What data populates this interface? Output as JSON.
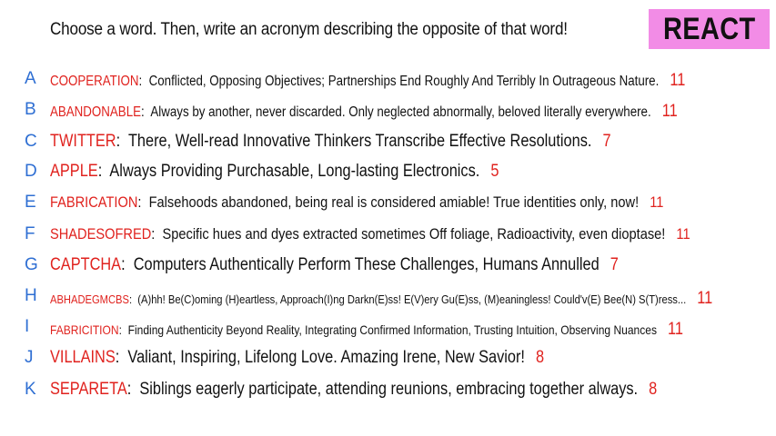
{
  "prompt": "Choose a word. Then, write an acronym describing the opposite of that word!",
  "badge": "REACT",
  "entries": [
    {
      "letter": "A",
      "word": "COOPERATION",
      "acronym": "Conflicted, Opposing Objectives; Partnerships End Roughly And Terribly In Outrageous Nature.",
      "count": "11"
    },
    {
      "letter": "B",
      "word": "ABANDONABLE",
      "acronym": "Always by another, never discarded. Only neglected abnormally, beloved literally everywhere.",
      "count": "11"
    },
    {
      "letter": "C",
      "word": "TWITTER",
      "acronym": "There, Well-read Innovative Thinkers Transcribe Effective Resolutions.",
      "count": "7"
    },
    {
      "letter": "D",
      "word": "APPLE",
      "acronym": "Always Providing Purchasable, Long-lasting Electronics.",
      "count": "5"
    },
    {
      "letter": "E",
      "word": "FABRICATION",
      "acronym": "Falsehoods abandoned, being real is considered amiable! True identities only, now!",
      "count": "11"
    },
    {
      "letter": "F",
      "word": "SHADESOFRED",
      "acronym": "Specific hues and dyes extracted sometimes Off foliage, Radioactivity, even dioptase!",
      "count": "11"
    },
    {
      "letter": "G",
      "word": "CAPTCHA",
      "acronym": "Computers Authentically Perform These Challenges, Humans Annulled",
      "count": "7"
    },
    {
      "letter": "H",
      "word": "ABHADEGMCBS",
      "acronym": "(A)hh! Be(C)oming (H)eartless, Approach(I)ng Darkn(E)ss! E(V)ery Gu(E)ss, (M)eaningless! Could'v(E) Bee(N) S(T)ress...",
      "count": "11"
    },
    {
      "letter": "I",
      "word": "FABRICITION",
      "acronym": "Finding Authenticity Beyond Reality, Integrating Confirmed Information, Trusting Intuition, Observing Nuances",
      "count": "11"
    },
    {
      "letter": "J",
      "word": "VILLAINS",
      "acronym": "Valiant, Inspiring, Lifelong Love. Amazing Irene, New Savior!",
      "count": "8"
    },
    {
      "letter": "K",
      "word": "SEPARETA",
      "acronym": "Siblings eagerly participate, attending reunions, embracing together always.",
      "count": "8"
    }
  ]
}
